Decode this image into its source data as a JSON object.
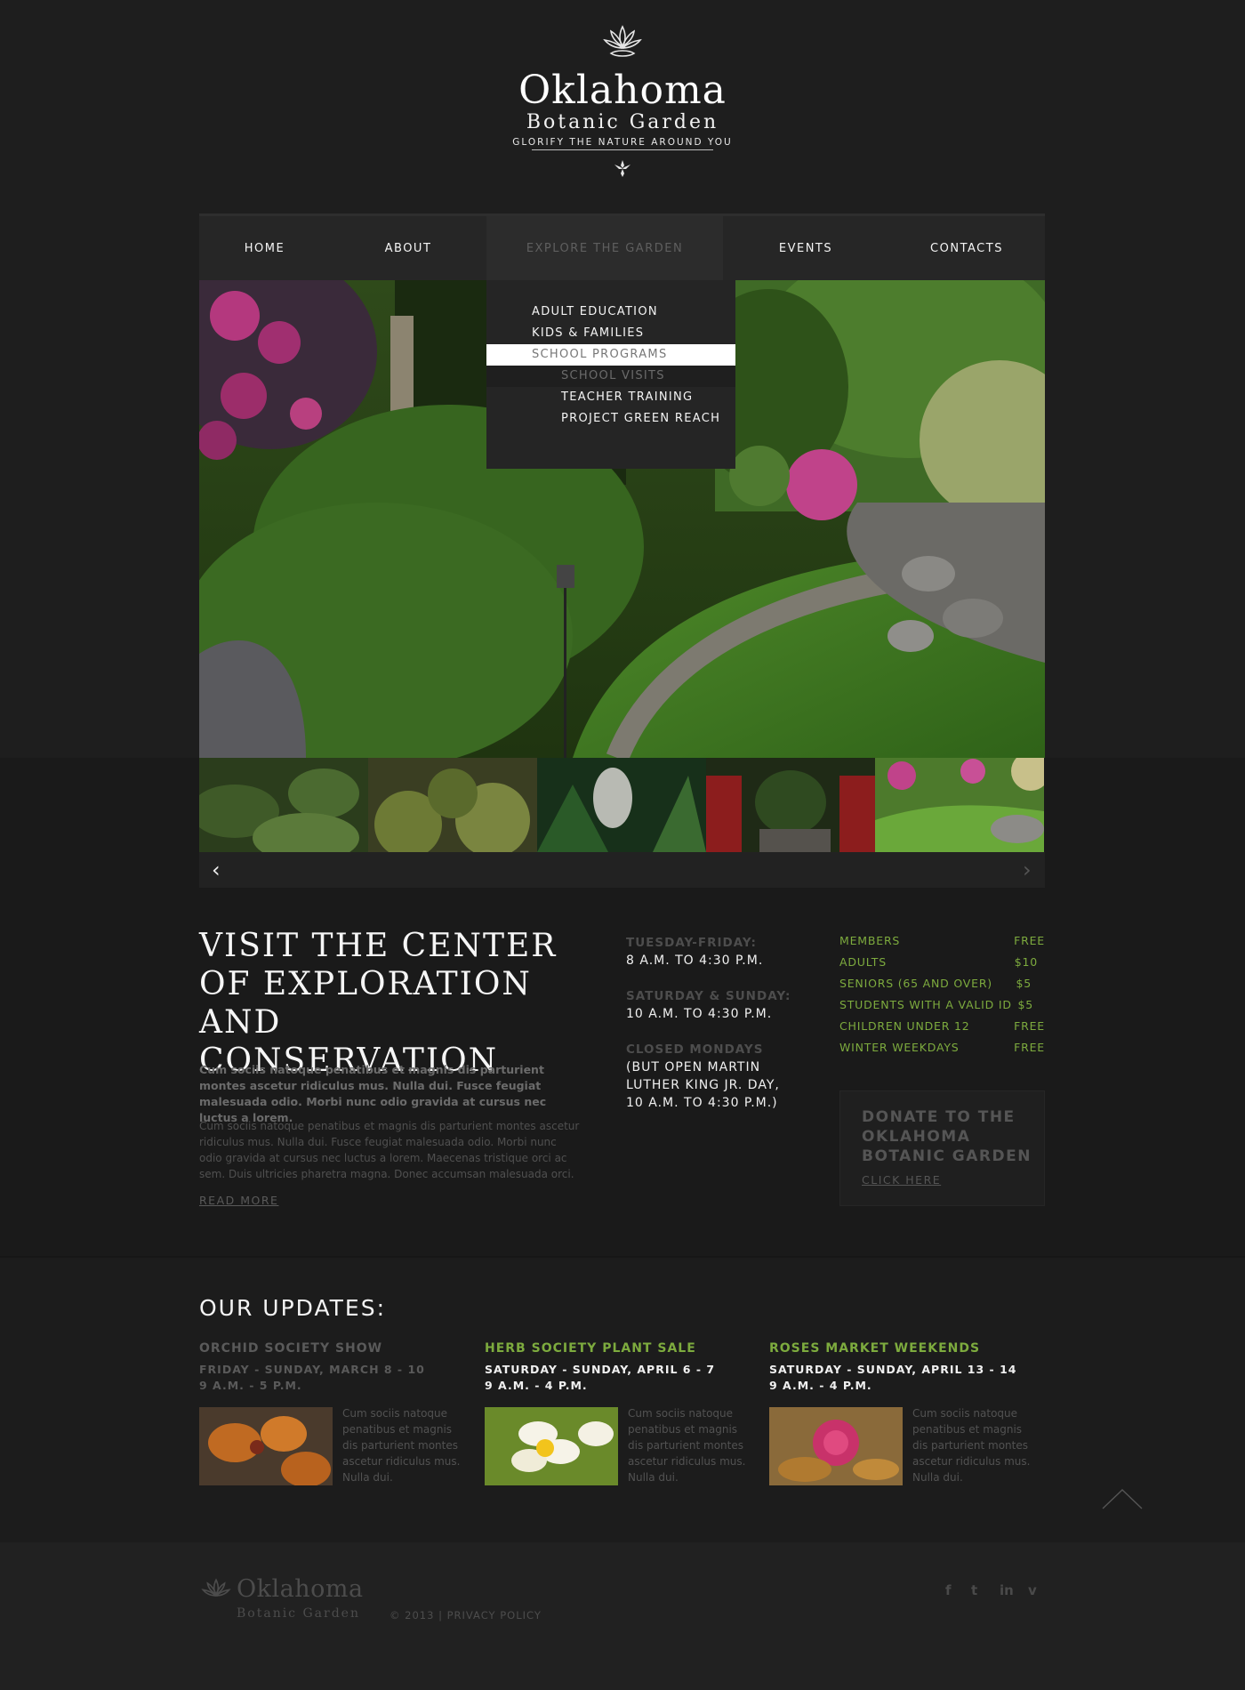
{
  "logo": {
    "line1": "Oklahoma",
    "line2": "Botanic Garden",
    "tagline": "GLORIFY THE NATURE AROUND YOU"
  },
  "nav": [
    "HOME",
    "ABOUT",
    "EXPLORE THE GARDEN",
    "EVENTS",
    "CONTACTS"
  ],
  "dropdown": {
    "items": [
      "ADULT EDUCATION",
      "KIDS & FAMILIES",
      "SCHOOL PROGRAMS"
    ],
    "subitems": [
      "SCHOOL VISITS",
      "TEACHER TRAINING",
      "PROJECT GREEN REACH"
    ]
  },
  "slider": {
    "prev": "‹",
    "next": "›"
  },
  "visit": {
    "title": "VISIT THE CENTER OF EXPLORATION AND CONSERVATION",
    "p1": "Cum sociis natoque penatibus et magnis dis parturient montes ascetur ridiculus mus. Nulla dui. Fusce feugiat malesuada odio. Morbi nunc odio gravida at cursus nec luctus a lorem.",
    "p2": "Cum sociis natoque penatibus et magnis dis parturient montes ascetur ridiculus mus. Nulla dui. Fusce feugiat malesuada odio. Morbi nunc odio gravida at cursus nec luctus a lorem. Maecenas tristique orci ac sem. Duis ultricies pharetra magna. Donec accumsan malesuada orci.",
    "read_more": "READ MORE"
  },
  "hours": [
    {
      "label": "TUESDAY-FRIDAY:",
      "value": "8 A.M. TO 4:30 P.M."
    },
    {
      "label": "SATURDAY & SUNDAY:",
      "value": "10 A.M. TO 4:30 P.M."
    },
    {
      "label": "CLOSED MONDAYS",
      "value": "(BUT OPEN MARTIN LUTHER KING JR. DAY, 10 A.M. TO 4:30 P.M.)"
    }
  ],
  "prices": [
    {
      "label": "MEMBERS",
      "value": "FREE"
    },
    {
      "label": "ADULTS",
      "value": "$10"
    },
    {
      "label": "SENIORS (65 AND OVER)",
      "value": "$5"
    },
    {
      "label": "STUDENTS WITH A VALID ID",
      "value": "$5"
    },
    {
      "label": "CHILDREN UNDER 12",
      "value": "FREE"
    },
    {
      "label": "WINTER WEEKDAYS",
      "value": "FREE"
    }
  ],
  "donate": {
    "title": "DONATE TO THE OKLAHOMA BOTANIC GARDEN",
    "link": "CLICK HERE"
  },
  "updates": {
    "title": "OUR UPDATES:",
    "items": [
      {
        "title": "ORCHID SOCIETY SHOW",
        "date": "FRIDAY - SUNDAY, MARCH 8 - 10",
        "time": "9 A.M. - 5 P.M.",
        "text": "Cum sociis natoque penatibus et magnis dis parturient montes ascetur ridiculus mus. Nulla dui."
      },
      {
        "title": "HERB SOCIETY PLANT SALE",
        "date": "SATURDAY - SUNDAY, APRIL 6 - 7",
        "time": "9 A.M. - 4 P.M.",
        "text": "Cum sociis natoque penatibus et magnis dis parturient montes ascetur ridiculus mus. Nulla dui."
      },
      {
        "title": "ROSES MARKET WEEKENDS",
        "date": "SATURDAY - SUNDAY, APRIL 13 - 14",
        "time": "9 A.M. - 4 P.M.",
        "text": "Cum sociis natoque penatibus et magnis dis parturient montes ascetur ridiculus mus. Nulla dui."
      }
    ]
  },
  "footer": {
    "line1": "Oklahoma",
    "line2": "Botanic Garden",
    "copyright": "© 2013 |",
    "privacy": "PRIVACY POLICY",
    "social": [
      "f",
      "t",
      "in",
      "v"
    ]
  },
  "colors": {
    "background": "#1d1d1d",
    "accent_green": "#7dab3e",
    "nav_bg": "#262626",
    "muted_text": "#555555"
  },
  "icons": [
    "lotus-ornament-icon",
    "fleur-ornament-icon",
    "chevron-left-icon",
    "chevron-right-icon",
    "scroll-top-icon",
    "facebook-icon",
    "twitter-icon",
    "linkedin-icon",
    "vimeo-icon"
  ]
}
